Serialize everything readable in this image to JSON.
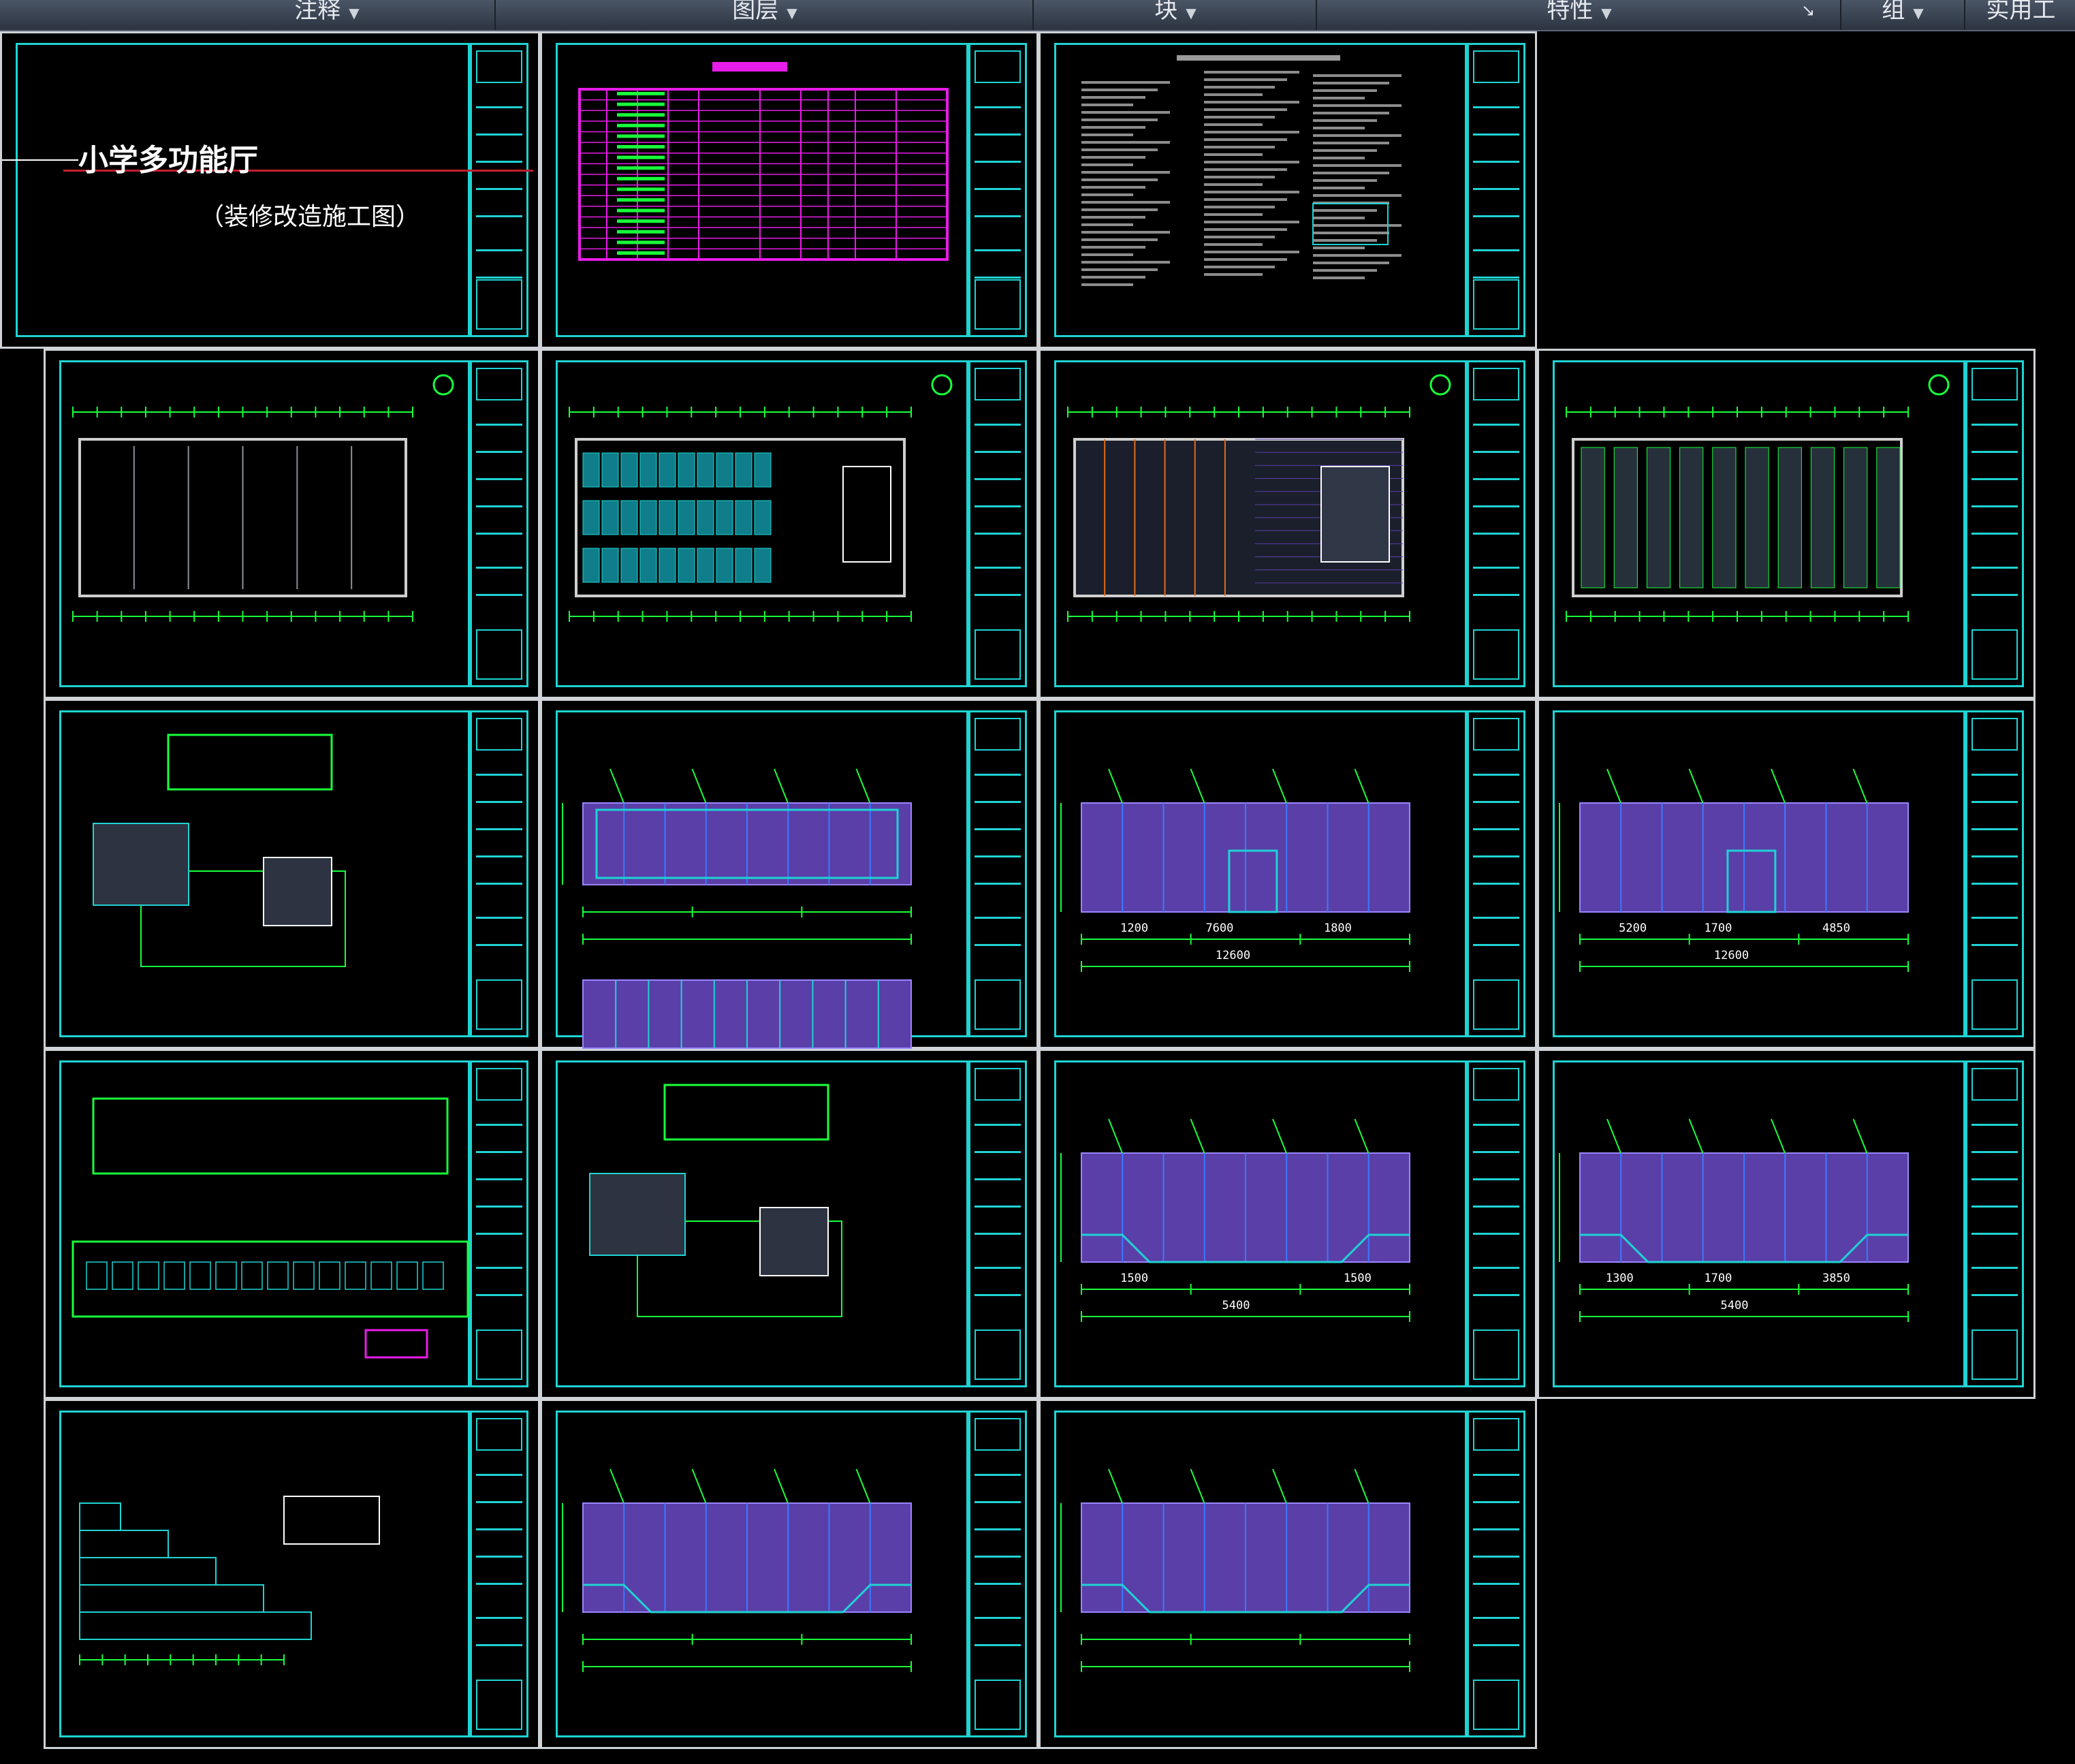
{
  "ribbon": {
    "panels": [
      {
        "label": "注释",
        "has_dropdown": true
      },
      {
        "label": "图层",
        "has_dropdown": true
      },
      {
        "label": "块",
        "has_dropdown": true
      },
      {
        "label": "特性",
        "has_dropdown": true
      },
      {
        "label": "组",
        "has_dropdown": true
      },
      {
        "label": "实用工",
        "has_dropdown": false
      }
    ],
    "expand_icon": "dialog-launcher-icon"
  },
  "cover": {
    "project_title": "小学多功能厅",
    "project_subtitle": "（装修改造施工图）"
  },
  "sheets": [
    {
      "id": "cover",
      "kind": "cover"
    },
    {
      "id": "drawing-index",
      "kind": "index-table"
    },
    {
      "id": "design-notes",
      "kind": "notes"
    },
    {
      "id": "plan-1",
      "kind": "plan"
    },
    {
      "id": "plan-2",
      "kind": "plan"
    },
    {
      "id": "plan-3",
      "kind": "plan"
    },
    {
      "id": "plan-4",
      "kind": "plan"
    },
    {
      "id": "detail-1",
      "kind": "detail"
    },
    {
      "id": "elevation-1",
      "kind": "elevation"
    },
    {
      "id": "elevation-2",
      "kind": "elevation"
    },
    {
      "id": "elevation-3",
      "kind": "elevation"
    },
    {
      "id": "section-1",
      "kind": "section"
    },
    {
      "id": "detail-2",
      "kind": "detail"
    },
    {
      "id": "elevation-4",
      "kind": "elevation"
    },
    {
      "id": "elevation-5",
      "kind": "elevation"
    },
    {
      "id": "section-2",
      "kind": "section"
    },
    {
      "id": "elevation-6",
      "kind": "elevation"
    },
    {
      "id": "elevation-7",
      "kind": "elevation"
    }
  ],
  "dimensions": {
    "elev_1": [
      "1200",
      "7600",
      "1800",
      "12600"
    ],
    "elev_2": [
      "5200",
      "1700",
      "4850",
      "12600"
    ],
    "elev_3": [
      "1500",
      "1500",
      "5400"
    ],
    "elev_4": [
      "1300",
      "1700",
      "3850",
      "5400"
    ]
  },
  "colors": {
    "frame": "#1fd3d3",
    "sheet_border": "#cfd2d6",
    "dim": "#19ff3a",
    "magenta": "#e81ce8",
    "wall": "#5a3fa8",
    "canvas": "#000000"
  }
}
